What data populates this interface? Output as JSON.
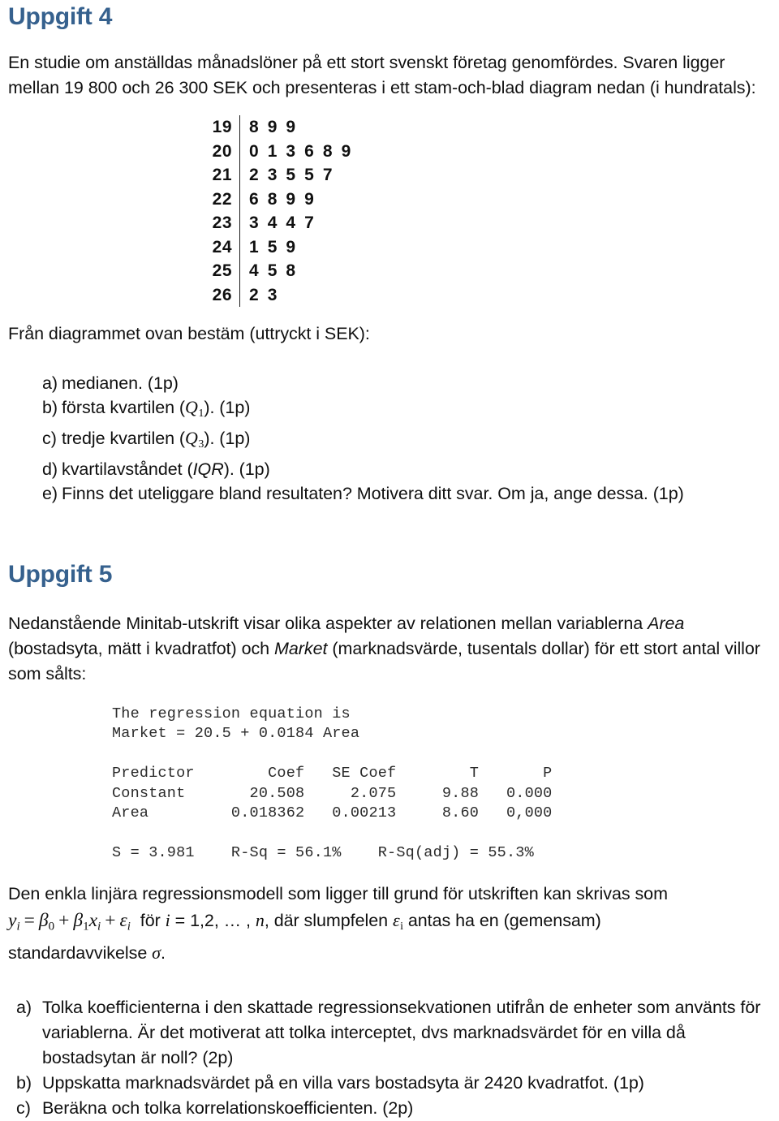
{
  "task4": {
    "heading": "Uppgift 4",
    "intro": "En studie om anställdas månadslöner på ett stort svenskt företag genomfördes. Svaren ligger mellan 19 800 och 26 300 SEK och presenteras i ett stam-och-blad diagram nedan (i hundratals):",
    "stemleaf": {
      "caption": "stam-och-blad diagram",
      "rows": [
        {
          "stem": "19",
          "leaves": "8 9 9"
        },
        {
          "stem": "20",
          "leaves": "0 1 3 6 8 9"
        },
        {
          "stem": "21",
          "leaves": "2 3 5 5 7"
        },
        {
          "stem": "22",
          "leaves": "6 8 9 9"
        },
        {
          "stem": "23",
          "leaves": "3 4 4 7"
        },
        {
          "stem": "24",
          "leaves": "1 5 9"
        },
        {
          "stem": "25",
          "leaves": "4 5 8"
        },
        {
          "stem": "26",
          "leaves": "2 3"
        }
      ]
    },
    "prompt": "Från diagrammet ovan bestäm (uttryckt i SEK):",
    "questions": [
      {
        "marker": "a)",
        "text": "medianen. (1p)"
      },
      {
        "marker": "b)",
        "text": "första kvartilen (Q1). (1p)"
      },
      {
        "marker": "c)",
        "text": "tredje kvartilen (Q3). (1p)"
      },
      {
        "marker": "d)",
        "text": "kvartilavståndet (IQR). (1p)"
      },
      {
        "marker": "e)",
        "text": "Finns det uteliggare bland resultaten? Motivera ditt svar. Om ja, ange dessa. (1p)"
      }
    ]
  },
  "task5": {
    "heading": "Uppgift 5",
    "intro_parts": {
      "p1": "Nedanstående Minitab-utskrift visar olika aspekter av relationen mellan variablerna ",
      "var1": "Area",
      "p2": " (bostadsyta, mätt i kvadratfot) och ",
      "var2": "Market",
      "p3": " (marknadsvärde, tusentals dollar) för ett stort antal villor som sålts:"
    },
    "minitab": {
      "equation_label": "The regression equation is",
      "equation": "Market = 20.5 + 0.0184 Area",
      "table": {
        "headers": [
          "Predictor",
          "Coef",
          "SE Coef",
          "T",
          "P"
        ],
        "rows": [
          [
            "Constant",
            "20.508",
            "2.075",
            "9.88",
            "0.000"
          ],
          [
            "Area",
            "0.018362",
            "0.00213",
            "8.60",
            "0,000"
          ]
        ]
      },
      "summary": {
        "s_label": "S",
        "s_value": "3.981",
        "rsq_label": "R-Sq",
        "rsq_value": "56.1%",
        "rsqadj_label": "R-Sq(adj)",
        "rsqadj_value": "55.3%"
      },
      "raw": "The regression equation is\nMarket = 20.5 + 0.0184 Area\n\nPredictor        Coef   SE Coef        T       P\nConstant       20.508     2.075     9.88   0.000\nArea         0.018362   0.00213     8.60   0,000\n\nS = 3.981    R-Sq = 56.1%    R-Sq(adj) = 55.3%"
    },
    "model_text": {
      "lead": "Den enkla linjära regressionsmodell som ligger till grund för utskriften kan skrivas som",
      "formula": "y_i = β_0 + β_1 x_i + ε_i",
      "middle": " för i = 1,2, … , n, där slumpfelen ε_i antas ha en (gemensam)",
      "tail": "standardavvikelse σ."
    },
    "questions": [
      {
        "marker": "a)",
        "text": "Tolka koefficienterna i den skattade regressionsekvationen utifrån de enheter som använts för variablerna. Är det motiverat att tolka interceptet, dvs marknadsvärdet för en villa då bostadsytan är noll? (2p)"
      },
      {
        "marker": "b)",
        "text": "Uppskatta marknadsvärdet på en villa vars bostadsyta är 2420 kvadratfot. (1p)"
      },
      {
        "marker": "c)",
        "text": "Beräkna och tolka korrelationskoefficienten. (2p)"
      }
    ]
  },
  "colors": {
    "heading_blue": "#36618e",
    "body_text": "#101010",
    "mono_text": "#2b2b2b"
  }
}
